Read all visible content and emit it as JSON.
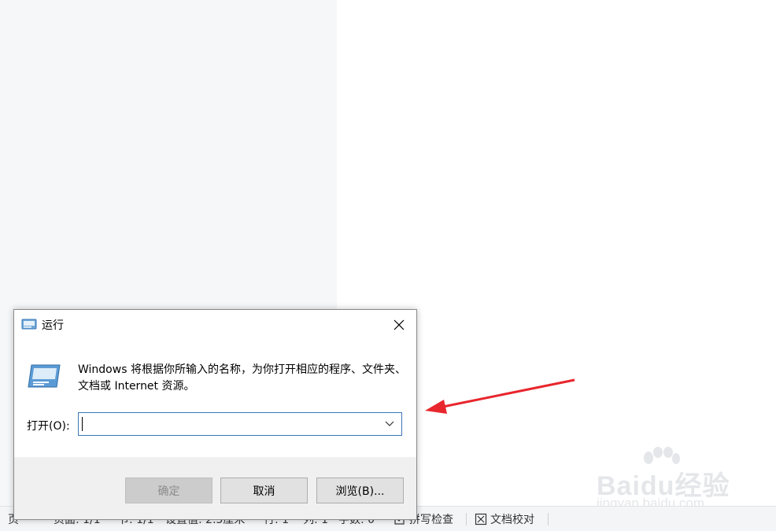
{
  "dialog": {
    "title": "运行",
    "description": "Windows 将根据你所输入的名称，为你打开相应的程序、文件夹、文档或 Internet 资源。",
    "open_label": "打开(O):",
    "input_value": "",
    "buttons": {
      "ok": "确定",
      "cancel": "取消",
      "browse": "浏览(B)..."
    }
  },
  "statusbar": {
    "items": [
      "页",
      "页面: 1/1",
      "节: 1/1",
      "设置值: 2.5厘米",
      "行: 1",
      "列: 1",
      "字数: 0",
      "拼写检查",
      "文档校对"
    ]
  },
  "watermark": {
    "logo": "Baidu经验",
    "url": "jingyan.baidu.com"
  },
  "colors": {
    "accent": "#3a76b8",
    "arrow": "#e8262d"
  }
}
